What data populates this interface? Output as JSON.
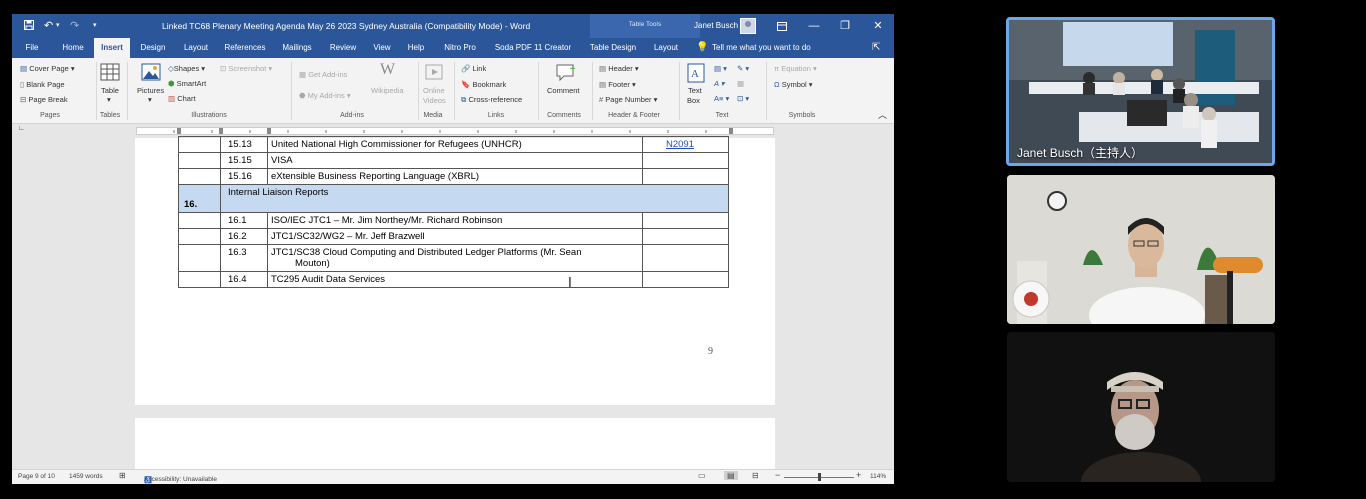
{
  "window": {
    "title": "Linked TC68 Plenary Meeting Agenda May 26 2023 Sydney Australia (Compatibility Mode) - Word",
    "contextual_tab": "Table Tools",
    "user": "Janet Busch"
  },
  "tabs": [
    "File",
    "Home",
    "Insert",
    "Design",
    "Layout",
    "References",
    "Mailings",
    "Review",
    "View",
    "Help",
    "Nitro Pro",
    "Soda PDF 11 Creator",
    "Table Design",
    "Layout"
  ],
  "tell_me": "Tell me what you want to do",
  "ribbon": {
    "pages": {
      "cover_page": "Cover Page",
      "blank_page": "Blank Page",
      "page_break": "Page Break",
      "label": "Pages"
    },
    "tables": {
      "table": "Table",
      "label": "Tables"
    },
    "illustrations": {
      "pictures": "Pictures",
      "shapes": "Shapes",
      "smartart": "SmartArt",
      "chart": "Chart",
      "screenshot": "Screenshot",
      "label": "Illustrations"
    },
    "addins": {
      "get_addins": "Get Add-ins",
      "my_addins": "My Add-ins",
      "wikipedia": "Wikipedia",
      "label": "Add-ins"
    },
    "media": {
      "online_videos_line1": "Online",
      "online_videos_line2": "Videos",
      "label": "Media"
    },
    "links": {
      "link": "Link",
      "bookmark": "Bookmark",
      "cross_reference": "Cross-reference",
      "label": "Links"
    },
    "comments": {
      "comment": "Comment",
      "label": "Comments"
    },
    "header_footer": {
      "header": "Header",
      "footer": "Footer",
      "page_number": "Page Number",
      "label": "Header & Footer"
    },
    "text": {
      "text_box_line1": "Text",
      "text_box_line2": "Box",
      "label": "Text"
    },
    "symbols": {
      "equation": "Equation",
      "symbol": "Symbol",
      "label": "Symbols"
    }
  },
  "document": {
    "rows": [
      {
        "num": "",
        "sub": "15.13",
        "text": "United National High Commissioner for Refugees (UNHCR)",
        "ref": "N2091",
        "type": "item"
      },
      {
        "num": "",
        "sub": "15.15",
        "text": "VISA",
        "ref": "",
        "type": "item"
      },
      {
        "num": "",
        "sub": "15.16",
        "text": "eXtensible Business Reporting Language (XBRL)",
        "ref": "",
        "type": "item"
      },
      {
        "num": "16.",
        "sub": "Internal Liaison Reports",
        "text": "",
        "ref": "",
        "type": "section"
      },
      {
        "num": "",
        "sub": "16.1",
        "text": "ISO/IEC JTC1 – Mr. Jim Northey/Mr. Richard Robinson",
        "ref": "",
        "type": "item"
      },
      {
        "num": "",
        "sub": "16.2",
        "text": "JTC1/SC32/WG2 – Mr. Jeff Brazwell",
        "ref": "",
        "type": "item"
      },
      {
        "num": "",
        "sub": "16.3",
        "text": "JTC1/SC38 Cloud Computing and Distributed Ledger Platforms (Mr. Sean",
        "text2": "Mouton)",
        "ref": "",
        "type": "item"
      },
      {
        "num": "",
        "sub": "16.4",
        "text": "TC295 Audit Data Services",
        "ref": "",
        "type": "item"
      }
    ],
    "page_number": "9"
  },
  "status": {
    "page": "Page 9 of 10",
    "words": "1459 words",
    "accessibility": "Accessibility: Unavailable",
    "zoom": "114%"
  },
  "video": {
    "presenter_label": "Janet Busch（主持人）"
  },
  "colors": {
    "word_blue": "#2b579a",
    "section_fill": "#c5d9f1",
    "active_speaker_border": "#6aa8e8"
  }
}
